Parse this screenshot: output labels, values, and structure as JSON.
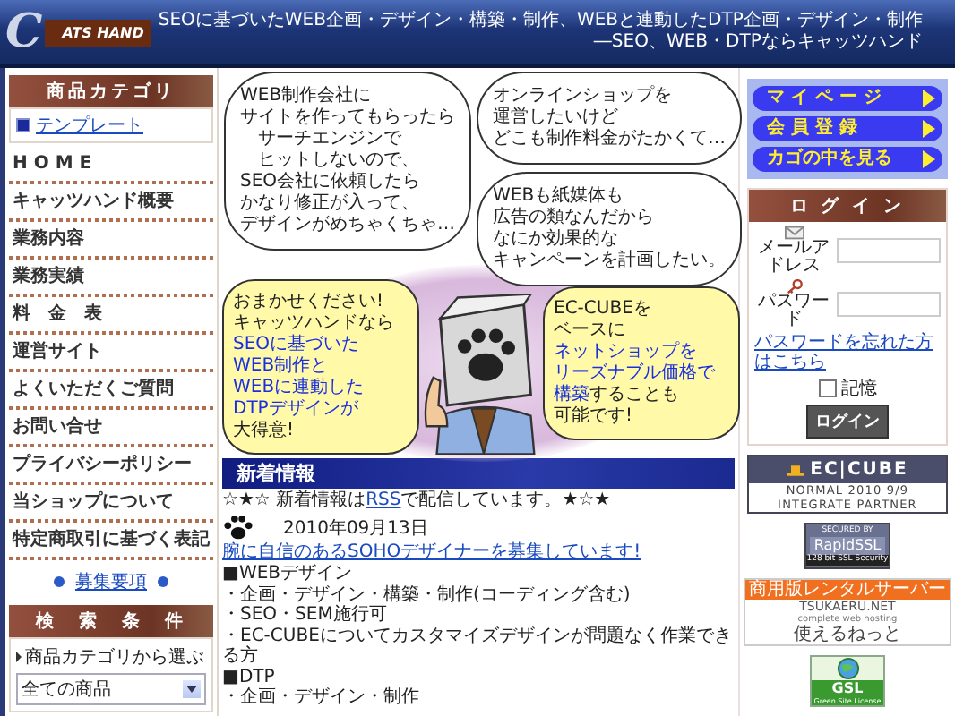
{
  "header": {
    "logo_initial": "C",
    "logo_text": "ATS HAND",
    "tagline": "SEOに基づいたWEB企画・デザイン・構築・制作、WEBと連動したDTP企画・デザイン・制作",
    "slogan": "―SEO、WEB・DTPならキャッツハンド"
  },
  "left": {
    "category_title": "商品カテゴリ",
    "categories": [
      "テンプレート"
    ],
    "menu": [
      "H O M E",
      "キャッツハンド概要",
      "業務内容",
      "業務実績",
      "料　金　表",
      "運営サイト",
      "よくいただくご質問",
      "お問い合せ",
      "プライバシーポリシー",
      "当ショップについて",
      "特定商取引に基づく表記"
    ],
    "recruit_link": "募集要項",
    "search_title": "検　索　条　件",
    "search_label": "商品カテゴリから選ぶ",
    "search_select": "全ての商品"
  },
  "comic": {
    "bubbles": [
      {
        "kind": "thought",
        "lines": [
          "WEB制作会社に",
          "サイトを作ってもらったら",
          "　サーチエンジンで",
          "　ヒットしないので、",
          "SEO会社に依頼したら",
          "かなり修正が入って、",
          "デザインがめちゃくちゃ…"
        ]
      },
      {
        "kind": "thought",
        "lines": [
          "オンラインショップを",
          "運営したいけど",
          "どこも制作料金がたかくて…"
        ]
      },
      {
        "kind": "thought",
        "lines": [
          "WEBも紙媒体も",
          "広告の類なんだから",
          "なにか効果的な",
          "キャンペーンを計画したい。"
        ]
      },
      {
        "kind": "speech",
        "lines": [
          "おまかせください!",
          "キャッツハンドなら",
          "**SEOに基づいた**",
          "**WEB制作と**",
          "**WEBに連動した**",
          "**DTPデザインが**",
          "大得意!"
        ]
      },
      {
        "kind": "speech",
        "lines": [
          "EC-CUBEを",
          "ベースに",
          "**ネットショップを**",
          "**リーズナブル価格で**",
          "**構築**することも",
          "可能です!"
        ]
      }
    ]
  },
  "news": {
    "title": "新着情報",
    "intro_before": "☆★☆ 新着情報は",
    "intro_link": "RSS",
    "intro_after": "で配信しています。★☆★",
    "date": "2010年09月13日",
    "link": "腕に自信のあるSOHOデザイナーを募集しています!",
    "lines": [
      "■WEBデザイン",
      "・企画・デザイン・構築・制作(コーディング含む)",
      "・SEO・SEM施行可",
      "・EC-CUBEについてカスタマイズデザインが問題なく作業できる方",
      "■DTP",
      "・企画・デザイン・制作"
    ]
  },
  "right": {
    "nav_buttons": [
      "マ イ ペ ー ジ",
      "会 員 登 録",
      "カゴの中を見る"
    ],
    "login": {
      "title": "ロ グ イ ン",
      "email_label": "メールアドレス",
      "password_label": "パスワード",
      "forgot_link": "パスワードを忘れた方はこちら",
      "remember_label": "記憶",
      "remember_checked": false,
      "button": "ログイン"
    },
    "eccube": {
      "brand": "EC|CUBE",
      "line1": "NORMAL 2010 9/9",
      "line2": "INTEGRATE PARTNER"
    },
    "rapidssl": {
      "top": "SECURED BY",
      "brand": "RapidSSL",
      "bottom": "128 bit SSL Security"
    },
    "tsukaeru": {
      "top": "商用版レンタルサーバー",
      "brand": "TSUKAERU.NET",
      "sub": "complete web hosting",
      "name": "使えるねっと"
    },
    "gsl": {
      "brand": "GSL",
      "sub": "Green Site License"
    }
  }
}
